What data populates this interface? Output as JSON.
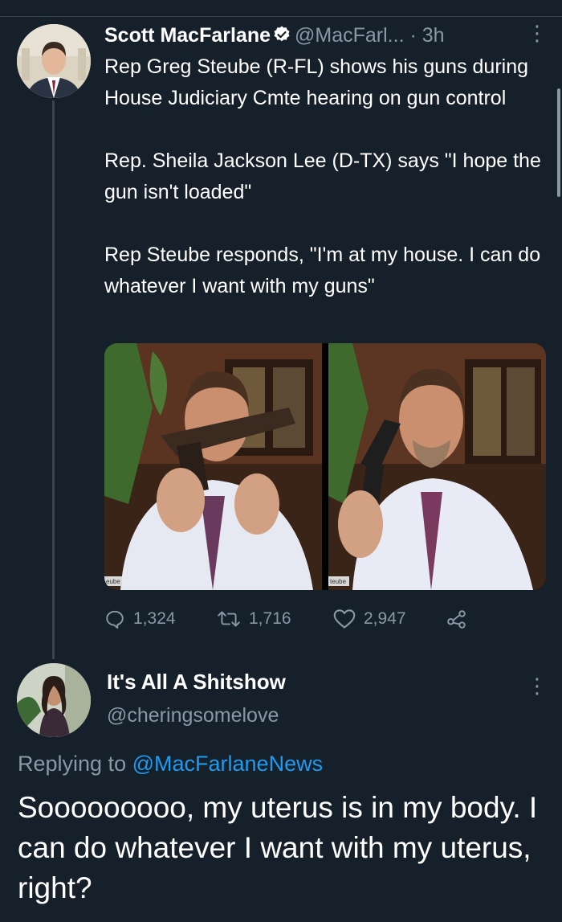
{
  "tweet": {
    "author_name": "Scott MacFarlane",
    "author_handle": "@MacFarl...",
    "time": "· 3h",
    "more_glyph": "⋮",
    "paragraphs": [
      "Rep Greg Steube (R-FL) shows his guns during House Judiciary Cmte hearing on gun control",
      "Rep. Sheila Jackson Lee (D-TX) says \"I hope the gun isn't loaded\"",
      "Rep Steube responds, \"I'm at my house. I can do whatever I want with my guns\""
    ],
    "media_captions": [
      "eube",
      "teube"
    ],
    "reply_count": "1,324",
    "retweet_count": "1,716",
    "like_count": "2,947"
  },
  "reply": {
    "author_name": "It's All A Shitshow",
    "author_handle": "@cheringsomelove",
    "more_glyph": "⋮",
    "replying_label": "Replying to",
    "replying_handle": "@MacFarlaneNews",
    "text": "Sooooooooo, my uterus is in my body. I can do whatever I want with my uterus, right?"
  },
  "colors": {
    "background": "#15202b",
    "secondary_text": "#8899a6",
    "link": "#1d9bf0",
    "verified": "#ffffff",
    "divider": "#38444d"
  },
  "icons": [
    "verified-badge-icon",
    "more-vertical-icon",
    "reply-icon",
    "retweet-icon",
    "like-icon",
    "share-icon"
  ]
}
